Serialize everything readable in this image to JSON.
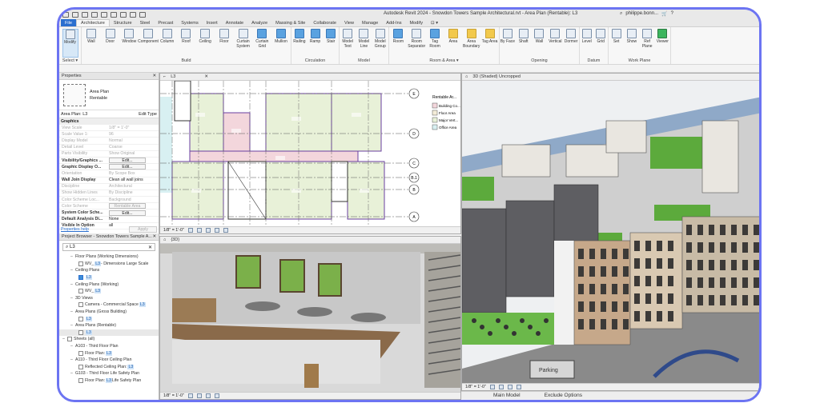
{
  "app": {
    "title": "Autodesk Revit 2024 - Snowdon Towers Sample Architectural.rvt - Area Plan (Rentable): L3",
    "user": "philippe.bonn..."
  },
  "tabs": [
    "File",
    "Architecture",
    "Structure",
    "Steel",
    "Precast",
    "Systems",
    "Insert",
    "Annotate",
    "Analyze",
    "Massing & Site",
    "Collaborate",
    "View",
    "Manage",
    "Add-Ins",
    "Modify",
    "⊡ ▾"
  ],
  "ribbon": [
    {
      "label": "Select ▾",
      "tools": [
        {
          "label": "Modify",
          "icon": "cursor-icon"
        }
      ]
    },
    {
      "label": "Build",
      "tools": [
        {
          "label": "Wall",
          "icon": "wall-icon"
        },
        {
          "label": "Door",
          "icon": "door-icon"
        },
        {
          "label": "Window",
          "icon": "window-icon"
        },
        {
          "label": "Component",
          "icon": "component-icon"
        },
        {
          "label": "Column",
          "icon": "column-icon"
        },
        {
          "label": "Roof",
          "icon": "roof-icon"
        },
        {
          "label": "Ceiling",
          "icon": "ceiling-icon"
        },
        {
          "label": "Floor",
          "icon": "floor-icon"
        },
        {
          "label": "Curtain System",
          "icon": "curtain-system-icon"
        },
        {
          "label": "Curtain Grid",
          "icon": "curtain-grid-icon"
        },
        {
          "label": "Mullion",
          "icon": "mullion-icon"
        }
      ]
    },
    {
      "label": "Circulation",
      "tools": [
        {
          "label": "Railing",
          "icon": "railing-icon"
        },
        {
          "label": "Ramp",
          "icon": "ramp-icon"
        },
        {
          "label": "Stair",
          "icon": "stair-icon"
        }
      ]
    },
    {
      "label": "Model",
      "tools": [
        {
          "label": "Model Text",
          "icon": "model-text-icon"
        },
        {
          "label": "Model Line",
          "icon": "model-line-icon"
        },
        {
          "label": "Model Group",
          "icon": "model-group-icon"
        }
      ]
    },
    {
      "label": "Room & Area ▾",
      "tools": [
        {
          "label": "Room",
          "icon": "room-icon"
        },
        {
          "label": "Room Separator",
          "icon": "room-separator-icon"
        },
        {
          "label": "Tag Room",
          "icon": "tag-room-icon"
        },
        {
          "label": "Area",
          "icon": "area-icon"
        },
        {
          "label": "Area Boundary",
          "icon": "area-boundary-icon"
        },
        {
          "label": "Tag Area",
          "icon": "tag-area-icon"
        }
      ]
    },
    {
      "label": "Opening",
      "tools": [
        {
          "label": "By Face",
          "icon": "by-face-icon"
        },
        {
          "label": "Shaft",
          "icon": "shaft-icon"
        },
        {
          "label": "Wall",
          "icon": "wall-opening-icon"
        },
        {
          "label": "Vertical",
          "icon": "vertical-icon"
        },
        {
          "label": "Dormer",
          "icon": "dormer-icon"
        }
      ]
    },
    {
      "label": "Datum",
      "tools": [
        {
          "label": "Level",
          "icon": "level-icon"
        },
        {
          "label": "Grid",
          "icon": "grid-icon"
        }
      ]
    },
    {
      "label": "Work Plane",
      "tools": [
        {
          "label": "Set",
          "icon": "set-icon"
        },
        {
          "label": "Show",
          "icon": "show-icon"
        },
        {
          "label": "Ref Plane",
          "icon": "ref-plane-icon"
        },
        {
          "label": "Viewer",
          "icon": "viewer-icon"
        }
      ]
    }
  ],
  "properties": {
    "header": "Properties",
    "type_name": "Area Plan",
    "type_sub": "Rentable",
    "selector": "Area Plan: L3",
    "edit_type": "Edit Type",
    "group": "Graphics",
    "rows": [
      {
        "k": "View Scale",
        "v": "1/8\" = 1'-0\"",
        "s": "dim"
      },
      {
        "k": "Scale Value    1:",
        "v": "96",
        "s": "dim"
      },
      {
        "k": "Display Model",
        "v": "Normal",
        "s": "dim"
      },
      {
        "k": "Detail Level",
        "v": "Coarse",
        "s": "dim"
      },
      {
        "k": "Parts Visibility",
        "v": "Show Original",
        "s": "dim"
      },
      {
        "k": "Visibility/Graphics ...",
        "v": "Edit...",
        "s": "bold",
        "btn": true
      },
      {
        "k": "Graphic Display O...",
        "v": "Edit...",
        "s": "bold",
        "btn": true
      },
      {
        "k": "Orientation",
        "v": "By Scope Box",
        "s": "dim"
      },
      {
        "k": "Wall Join Display",
        "v": "Clean all wall joins",
        "s": "bold"
      },
      {
        "k": "Discipline",
        "v": "Architectural",
        "s": "dim"
      },
      {
        "k": "Show Hidden Lines",
        "v": "By Discipline",
        "s": "dim"
      },
      {
        "k": "Color Scheme Loc...",
        "v": "Background",
        "s": "dim"
      },
      {
        "k": "Color Scheme",
        "v": "Rentable Area",
        "s": "dim",
        "btn": true
      },
      {
        "k": "System Color Sche...",
        "v": "Edit...",
        "s": "bold",
        "btn": true
      },
      {
        "k": "Default Analysis Di...",
        "v": "None",
        "s": "bold"
      },
      {
        "k": "Visible In Option",
        "v": "all",
        "s": "bold"
      }
    ],
    "help": "Properties help",
    "apply": "Apply"
  },
  "browser": {
    "header": "Project Browser - Snowdon Towers Sample A...",
    "search": "L3",
    "items": [
      {
        "t": "Floor Plans (Working Dimensions)",
        "l": 1
      },
      {
        "t": "WV_",
        "b": "L3",
        "a": " - Dimensions Large Scale",
        "l": 2
      },
      {
        "t": "Ceiling Plans",
        "l": 1
      },
      {
        "t": "",
        "b": "L3",
        "l": 2,
        "blue": true
      },
      {
        "t": "Ceiling Plans (Working)",
        "l": 1
      },
      {
        "t": "WV_",
        "b": "L3",
        "l": 2
      },
      {
        "t": "3D Views",
        "l": 1
      },
      {
        "t": "Camera - Commercial Space ",
        "b": "L3",
        "l": 2
      },
      {
        "t": "Area Plans (Gross Building)",
        "l": 1
      },
      {
        "t": "",
        "b": "L3",
        "l": 2
      },
      {
        "t": "Area Plans (Rentable)",
        "l": 1
      },
      {
        "t": "",
        "b": "L3",
        "l": 2,
        "hl": true
      },
      {
        "t": "Sheets (all)",
        "l": 0
      },
      {
        "t": "A103 - Third Floor Plan",
        "l": 1
      },
      {
        "t": "Floor Plan: ",
        "b": "L3",
        "l": 2
      },
      {
        "t": "A110 - Third Floor Ceiling Plan",
        "l": 1
      },
      {
        "t": "Reflected Ceiling Plan: ",
        "b": "L3",
        "l": 2
      },
      {
        "t": "G103 - Third Floor Life Safety Plan",
        "l": 1
      },
      {
        "t": "Floor Plan: ",
        "b": "L3",
        "a": " Life Safety Plan",
        "l": 2
      }
    ]
  },
  "views": {
    "plan": {
      "tab": "L3",
      "scale": "1/8\" = 1'-0\"",
      "legend_title": "Rentable Ar...",
      "legend": [
        {
          "t": "Building Co...",
          "c": "#f3d6dc"
        },
        {
          "t": "Floor Area",
          "c": "#f4ecd8"
        },
        {
          "t": "Major Vert...",
          "c": "#e8f1d8"
        },
        {
          "t": "Office Area",
          "c": "#d8f0f2"
        }
      ],
      "grids": [
        "E",
        "D",
        "C",
        "B.1",
        "B",
        "A"
      ]
    },
    "interior": {
      "tab": "{3D}",
      "scale": "1/8\" = 1'-0\""
    },
    "exterior": {
      "tab": "3D (Shaded) Uncropped",
      "scale": "1/8\" = 1'-0\"",
      "sign": "Parking",
      "status": [
        "Main Model",
        "Exclude Options"
      ]
    }
  },
  "colors": {
    "accent": "#2a6fcf",
    "frame": "#6c74f2",
    "room": "#e8f1d8",
    "corridor": "#f3d6dc",
    "boundary": "#6a3fa0"
  }
}
